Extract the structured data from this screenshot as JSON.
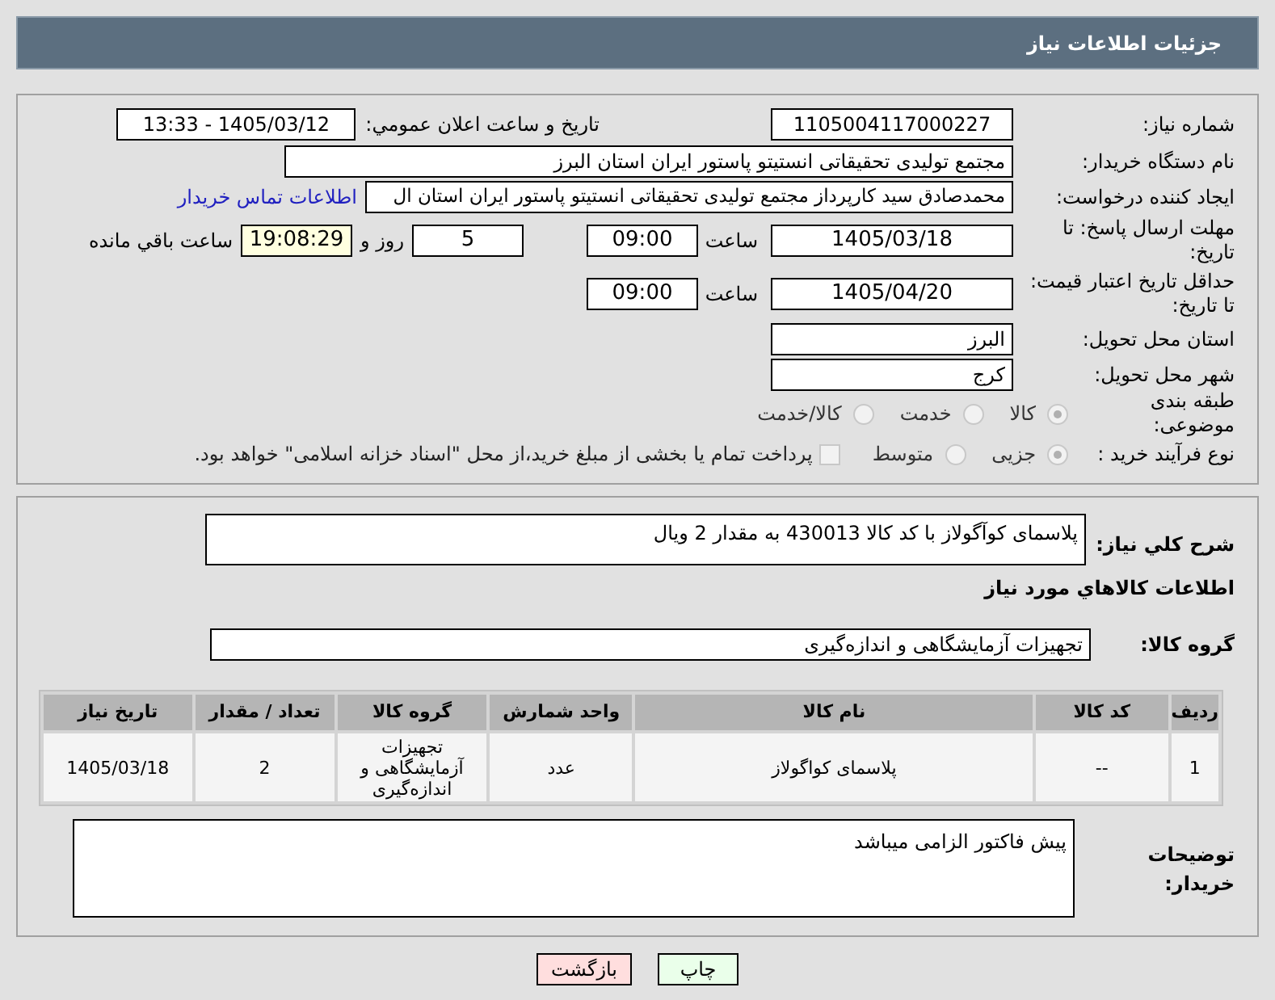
{
  "header": {
    "title": "جزئیات اطلاعات نیاز"
  },
  "form": {
    "need_number": {
      "label": "شماره نیاز:",
      "value": "1105004117000227"
    },
    "announce": {
      "label": "تاریخ و ساعت اعلان عمومي:",
      "value": "1405/03/12 - 13:33"
    },
    "buyer": {
      "label": "نام دستگاه خریدار:",
      "value": "مجتمع تولیدی تحقیقاتی انستیتو پاستور ایران استان البرز"
    },
    "creator": {
      "label": "ایجاد کننده درخواست:",
      "value": "محمدصادق سید کارپرداز مجتمع تولیدی تحقیقاتی انستیتو پاستور ایران استان ال",
      "link": "اطلاعات تماس خریدار"
    },
    "reply_deadline": {
      "label": "مهلت ارسال پاسخ: تا تاریخ:",
      "date": "1405/03/18",
      "time_label": "ساعت",
      "time": "09:00",
      "days": "5",
      "days_label": "روز و",
      "remaining": "19:08:29",
      "remaining_label": "ساعت باقي مانده"
    },
    "price_validity": {
      "label": "حداقل تاریخ اعتبار قیمت: تا تاریخ:",
      "date": "1405/04/20",
      "time_label": "ساعت",
      "time": "09:00"
    },
    "province": {
      "label": "استان محل تحویل:",
      "value": "البرز"
    },
    "city": {
      "label": "شهر محل تحویل:",
      "value": "کرج"
    },
    "category": {
      "label": "طبقه بندی موضوعی:",
      "options": [
        {
          "label": "کالا",
          "selected": true
        },
        {
          "label": "خدمت",
          "selected": false
        },
        {
          "label": "کالا/خدمت",
          "selected": false
        }
      ]
    },
    "purchase_type": {
      "label": "نوع فرآیند خرید :",
      "options": [
        {
          "label": "جزیی",
          "selected": true
        },
        {
          "label": "متوسط",
          "selected": false
        }
      ],
      "treasury": {
        "label": "پرداخت تمام یا بخشی از مبلغ خرید،از محل \"اسناد خزانه اسلامی\" خواهد بود.",
        "checked": false
      }
    }
  },
  "details": {
    "description": {
      "label": "شرح کلي نیاز:",
      "value": "پلاسمای کوآگولاز با کد کالا 430013 به مقدار 2 ویال"
    },
    "items_heading": "اطلاعات کالاهاي مورد نیاز",
    "goods_group": {
      "label": "گروه کالا:",
      "value": "تجهیزات آزمایشگاهی و اندازه‌گیری"
    },
    "table": {
      "columns": [
        "ردیف",
        "کد کالا",
        "نام کالا",
        "واحد شمارش",
        "گروه کالا",
        "تعداد / مقدار",
        "تاریخ نیاز"
      ],
      "rows": [
        [
          "1",
          "--",
          "پلاسمای کواگولاز",
          "عدد",
          "تجهیزات آزمایشگاهی و اندازه‌گیری",
          "2",
          "1405/03/18"
        ]
      ]
    },
    "buyer_notes": {
      "label": "توضیحات خریدار:",
      "value": "پیش فاکتور الزامی میباشد"
    }
  },
  "buttons": [
    {
      "label": "چاپ",
      "kind": "print"
    },
    {
      "label": "بازگشت",
      "kind": "back"
    }
  ]
}
